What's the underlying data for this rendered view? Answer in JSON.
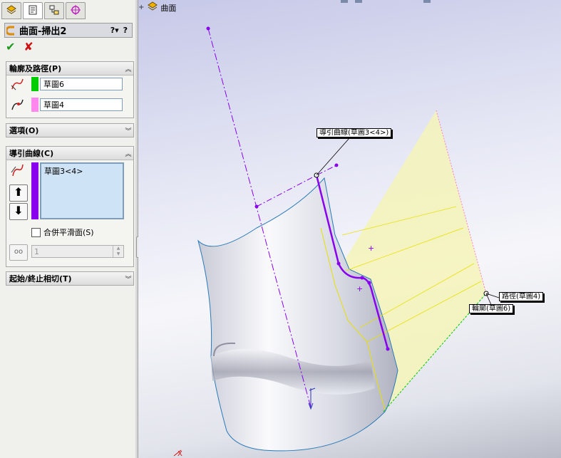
{
  "tabs": [
    {
      "name": "featuremanager-tab-icon"
    },
    {
      "name": "propertymanager-tab-icon"
    },
    {
      "name": "configurationmanager-tab-icon"
    },
    {
      "name": "dimxpert-tab-icon"
    }
  ],
  "propertymanager": {
    "title": "曲面-掃出2",
    "help_label": "?",
    "ok_symbol": "✔",
    "cancel_symbol": "✘"
  },
  "profile_path": {
    "header": "輪廓及路徑(P)",
    "profile_value": "草圖6",
    "path_value": "草圖4",
    "profile_color": "#00cc00",
    "path_color": "#ff88ee"
  },
  "options": {
    "header": "選項(O)"
  },
  "guide_curves": {
    "header": "導引曲線(C)",
    "items": [
      "草圖3<4>"
    ],
    "swatch_color": "#8800ee",
    "merge_smooth_label": "合併平滑面(S)",
    "spin_value": "1"
  },
  "start_end_tangency": {
    "header": "起始/終止相切(T)"
  },
  "viewport": {
    "breadcrumb": "曲面",
    "callouts": {
      "guide_curve": "導引曲線(草圖3<4>)",
      "path": "路徑(草圖4)",
      "profile": "輪廓(草圖6)"
    },
    "triad_label": "X"
  }
}
